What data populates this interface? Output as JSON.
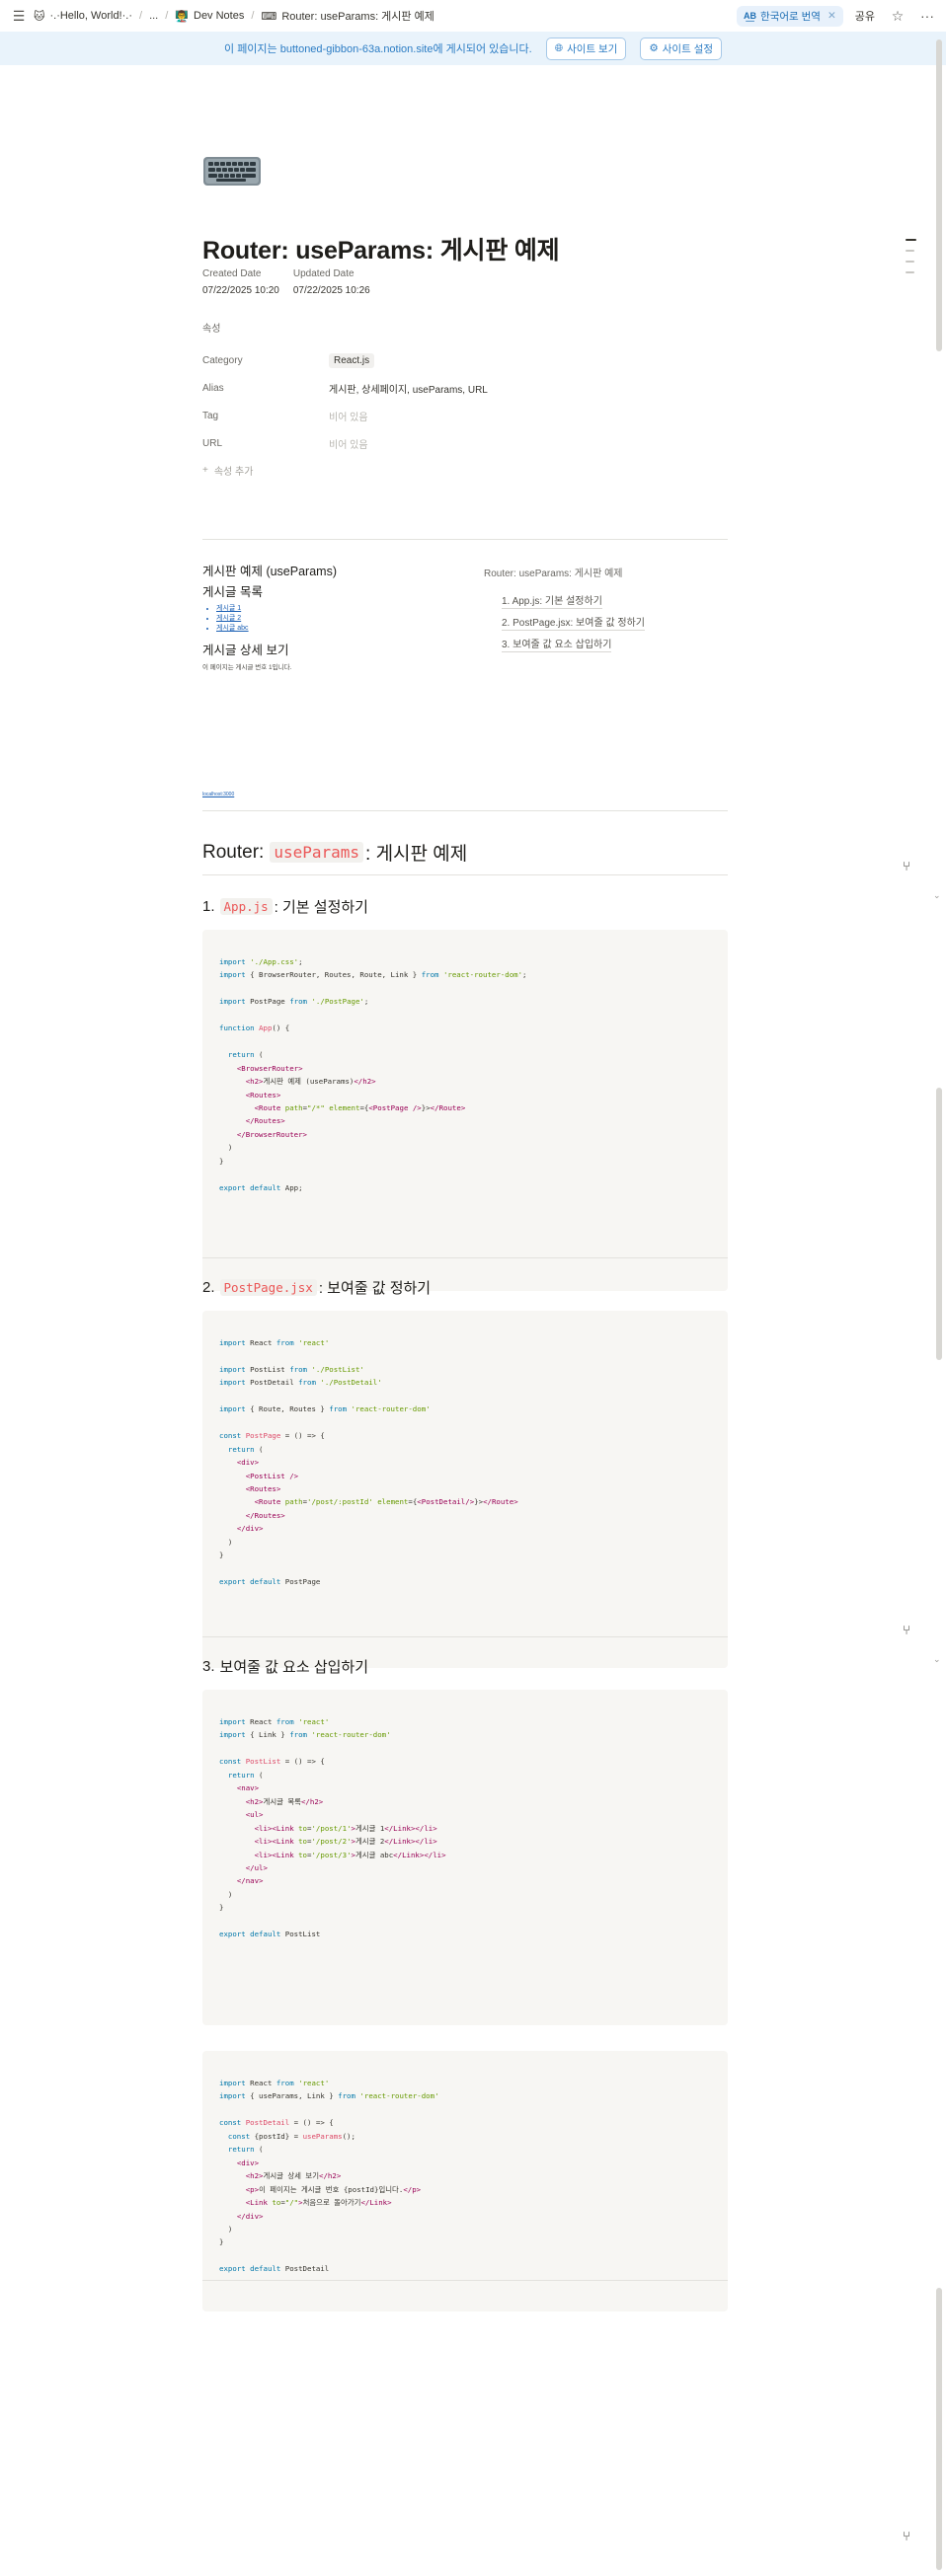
{
  "topbar": {
    "menu_icon": "menu-icon",
    "breadcrumb": [
      {
        "emoji": "🐱",
        "label": "·.·Hello, World!·.·"
      },
      {
        "emoji": "",
        "label": "..."
      },
      {
        "emoji": "👨‍🏫",
        "label": "Dev Notes"
      },
      {
        "emoji": "⌨",
        "label": "Router: useParams: 게시판 예제"
      }
    ],
    "translate_label": "한국어로 번역",
    "translate_badge": "A͟B",
    "share_label": "공유",
    "star_icon": "star-icon",
    "more_icon": "more-icon"
  },
  "banner": {
    "text": "이 페이지는 buttoned-gibbon-63a.notion.site에 게시되어 있습니다.",
    "view_site": "사이트 보기",
    "site_settings": "사이트 설정"
  },
  "page": {
    "title": "Router: useParams: 게시판 예제",
    "created_label": "Created Date",
    "created_value": "07/22/2025 10:20",
    "updated_label": "Updated Date",
    "updated_value": "07/22/2025 10:26",
    "props_header": "속성",
    "props": {
      "category_label": "Category",
      "category_value": "React.js",
      "alias_label": "Alias",
      "alias_value": "게시판, 상세페이지, useParams, URL",
      "tag_label": "Tag",
      "tag_value": "비어 있음",
      "url_label": "URL",
      "url_value": "비어 있음",
      "add_label": "속성 추가"
    }
  },
  "embed": {
    "title": "게시판 예제 (useParams)",
    "list_title": "게시글 목록",
    "items": [
      "게시글 1",
      "게시글 2",
      "게시글 abc"
    ],
    "detail_title": "게시글 상세 보기",
    "detail_text": "이 페이지는 게시글 번호 1입니다."
  },
  "toc": {
    "title": "Router: useParams: 게시판 예제",
    "items": [
      "1. App.js: 기본 설정하기",
      "2. PostPage.jsx: 보여줄 값 정하기",
      "3. 보여줄 값 요소 삽입하기"
    ]
  },
  "tiny_link": "localhost:3000",
  "section_h1": {
    "prefix": "Router:",
    "code": "useParams",
    "suffix": ": 게시판 예제"
  },
  "sections": [
    {
      "num": "1.",
      "code": "App.js",
      "suffix": ": 기본 설정하기"
    },
    {
      "num": "2.",
      "code": "PostPage.jsx",
      "suffix": ": 보여줄 값 정하기"
    },
    {
      "num": "3.",
      "code": "",
      "suffix": "보여줄 값 요소 삽입하기"
    }
  ]
}
